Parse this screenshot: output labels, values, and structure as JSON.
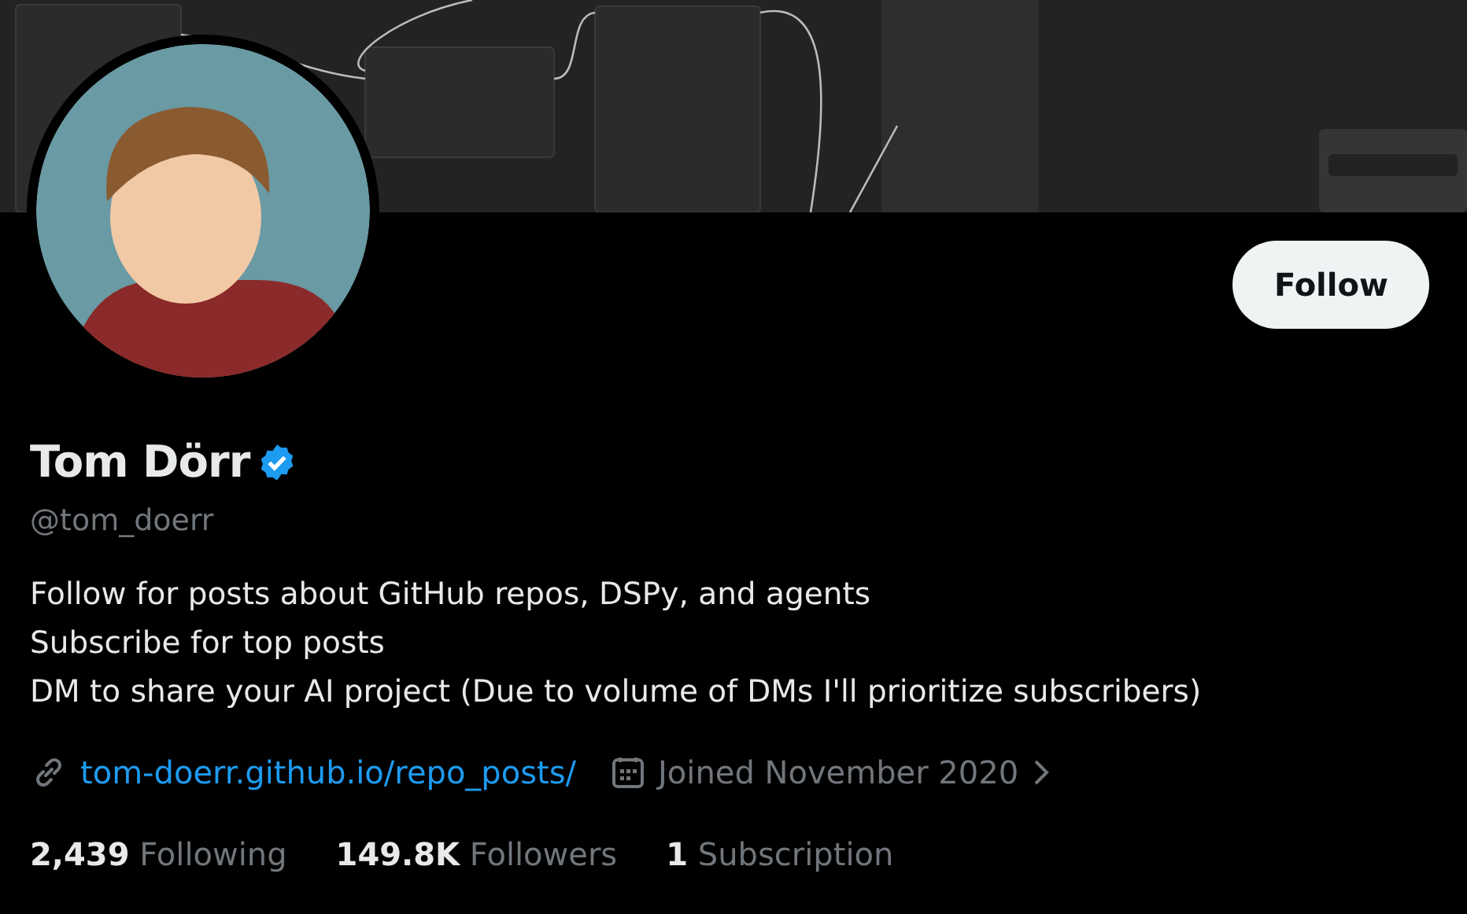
{
  "profile": {
    "name": "Tom Dörr",
    "verified": true,
    "handle": "@tom_doerr"
  },
  "follow_button": {
    "label": "Follow"
  },
  "bio": [
    "Follow for posts about GitHub repos, DSPy, and agents",
    "Subscribe for top posts",
    "DM to share your AI project (Due to volume of DMs I'll prioritize subscribers)"
  ],
  "details": {
    "website": "tom-doerr.github.io/repo_posts/",
    "joined": "Joined November 2020"
  },
  "stats": [
    {
      "count": "2,439",
      "label": "Following"
    },
    {
      "count": "149.8K",
      "label": "Followers"
    },
    {
      "count": "1",
      "label": "Subscription"
    }
  ]
}
